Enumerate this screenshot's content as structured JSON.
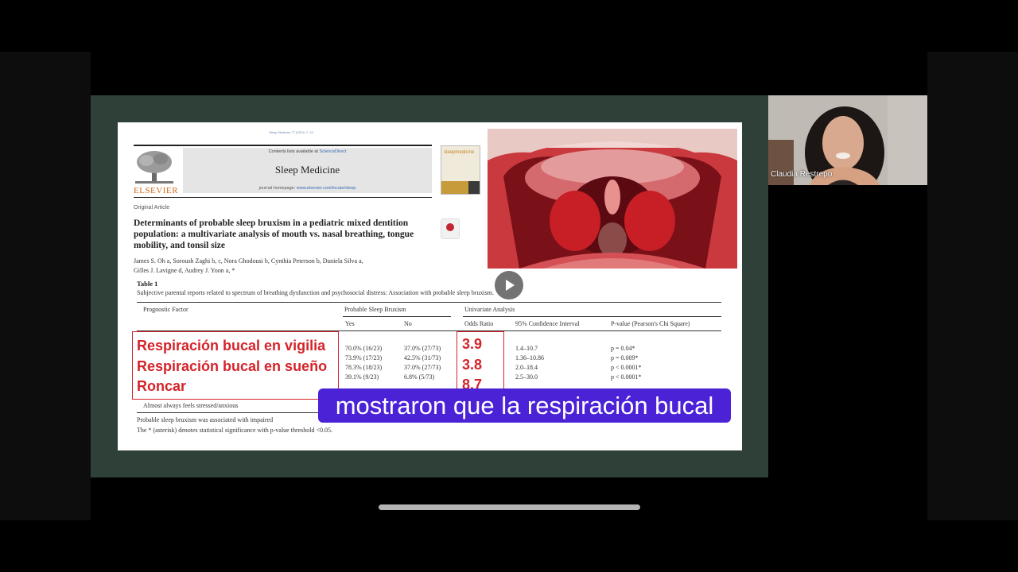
{
  "paper": {
    "journal_ref": "Sleep Medicine 77 (2021) 7–13",
    "contents_prefix": "Contents lists available at ",
    "contents_link": "ScienceDirect",
    "journal_title": "Sleep Medicine",
    "homepage_prefix": "journal homepage: ",
    "homepage_link": "www.elsevier.com/locate/sleep",
    "publisher": "ELSEVIER",
    "cover_title": "sleepmedicine",
    "article_type": "Original Article",
    "title": "Determinants of probable sleep bruxism in a pediatric mixed dentition population: a multivariate analysis of mouth vs. nasal breathing, tongue mobility, and tonsil size",
    "authors_line1": "James S. Oh a, Soroush Zaghi b, c, Nora Ghodousi b, Cynthia Peterson b, Daniela Silva a,",
    "authors_line2": "Gilles J. Lavigne d, Audrey J. Yoon a, *"
  },
  "table": {
    "number": "Table 1",
    "caption": "Subjective parental reports related to spectrum of breathing dysfunction and psychosocial distress: Association with probable sleep bruxism.",
    "headers": {
      "factor": "Prognostic Factor",
      "group": "Probable Sleep Bruxism",
      "yes": "Yes",
      "no": "No",
      "analysis": "Univariate Analysis",
      "or": "Odds Ratio",
      "ci": "95% Confidence Interval",
      "p": "P-value (Pearson's Chi Square)"
    },
    "rows": [
      {
        "yes": "70.0% (16/23)",
        "no": "37.0% (27/73)",
        "ci": "1.4–10.7",
        "p": "p = 0.04*"
      },
      {
        "yes": "73.9% (17/23)",
        "no": "42.5% (31/73)",
        "ci": "1.36–10.86",
        "p": "p = 0.009*"
      },
      {
        "yes": "78.3% (18/23)",
        "no": "37.0% (27/73)",
        "ci": "2.0–18.4",
        "p": "p < 0.0001*"
      },
      {
        "yes": "39.1% (9/23)",
        "no": "6.8% (5/73)",
        "ci": "2.5–30.0",
        "p": "p < 0.0001*"
      }
    ],
    "last_row_label": "Almost always feels stressed/anxious",
    "footnote1": "Probable sleep bruxism was associated with impaired",
    "footnote2": "The * (asterisk) denotes statistical significance with p-value threshold <0.05."
  },
  "overlay": {
    "labels": [
      "Respiración bucal en vigilia",
      "Respiración bucal en sueño",
      "Roncar"
    ],
    "odds": [
      "3.9",
      "3.8",
      "8.7"
    ]
  },
  "subtitle": "mostraron que la respiración bucal",
  "participant": {
    "name": "Claudia Restrepo"
  }
}
